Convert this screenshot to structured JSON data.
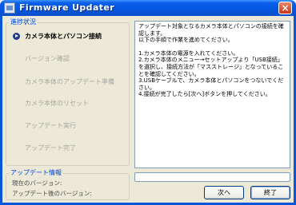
{
  "window": {
    "title": "Firmware Updater",
    "app_icon": "app-icon",
    "close_glyph": "×"
  },
  "steps": {
    "group_title": "進捗状況",
    "items": [
      {
        "label": "カメラ本体とパソコン接続",
        "active": true
      },
      {
        "label": "バージョン確認",
        "active": false
      },
      {
        "label": "カメラ本体のアップデート準備",
        "active": false
      },
      {
        "label": "カメラ本体のリセット",
        "active": false
      },
      {
        "label": "アップデート実行",
        "active": false
      },
      {
        "label": "アップデート完了",
        "active": false
      }
    ]
  },
  "instructions": {
    "intro": "アップデート対象となるカメラ本体とパソコンの接続を確認します。\n以下の手順で作業を進めてください。",
    "lines": [
      "1.カメラ本体の電源を入れてください。",
      "2.カメラ本体のメニュー→セットアップより「USB接続」を選択し、接続方法が「マスストレージ」となっていることを確認してください。",
      "3.USBケーブルで、カメラ本体とパソコンをつないでください。",
      "4.接続が完了したら[次へ]ボタンを押してください。"
    ]
  },
  "update_info": {
    "group_title": "アップデート情報",
    "current_version_label": "現在のバージョン:",
    "after_version_label": "アップデート後のバージョン:"
  },
  "progress": {
    "value": 0
  },
  "buttons": {
    "next_label": "次へ",
    "finish_label": "終了"
  },
  "colors": {
    "titlebar": "#0a5ee8",
    "group_title": "#0046d5",
    "disabled_text": "#a6a6a0",
    "dialog_bg": "#ece9d8"
  }
}
